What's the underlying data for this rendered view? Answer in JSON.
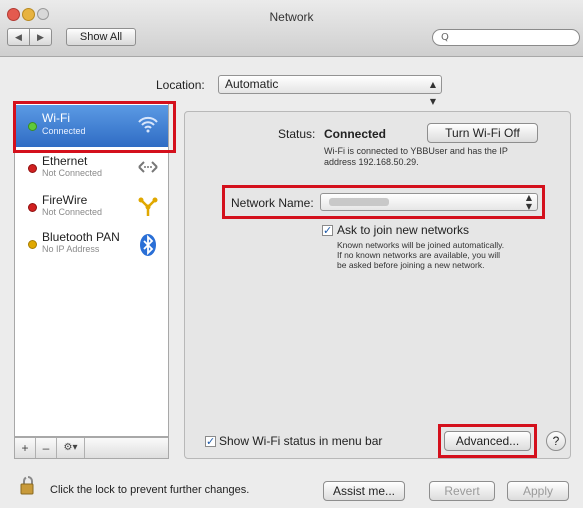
{
  "window": {
    "title": "Network"
  },
  "toolbar": {
    "show_all_label": "Show All",
    "search_placeholder": "Q"
  },
  "location": {
    "label": "Location:",
    "value": "Automatic"
  },
  "sidebar": {
    "items": [
      {
        "name": "Wi-Fi",
        "status": "Connected"
      },
      {
        "name": "Ethernet",
        "status": "Not Connected"
      },
      {
        "name": "FireWire",
        "status": "Not Connected"
      },
      {
        "name": "Bluetooth PAN",
        "status": "No IP Address"
      }
    ],
    "add_label": "+",
    "remove_label": "–",
    "gear_label": "⚙▾"
  },
  "detail": {
    "status_label": "Status:",
    "status_value": "Connected",
    "turn_off_label": "Turn Wi-Fi Off",
    "status_desc_line1": "Wi-Fi is connected to YBBUser and has the IP",
    "status_desc_line2": "address 192.168.50.29.",
    "network_name_label": "Network Name:",
    "ask_join_label": "Ask to join new networks",
    "ask_join_desc_line1": "Known networks will be joined automatically.",
    "ask_join_desc_line2": "If no known networks are available, you will",
    "ask_join_desc_line3": "be asked before joining a new network.",
    "show_status_label": "Show Wi-Fi status in menu bar",
    "advanced_label": "Advanced...",
    "help_label": "?"
  },
  "footer": {
    "lock_text": "Click the lock to prevent further changes.",
    "assist_label": "Assist me...",
    "revert_label": "Revert",
    "apply_label": "Apply"
  },
  "colors": {
    "selection": "#3d7fd6",
    "highlight_box": "#d4101c",
    "red_dot": "#d02020",
    "yellow_dot": "#e0a800",
    "green_dot": "#5fc93a"
  }
}
